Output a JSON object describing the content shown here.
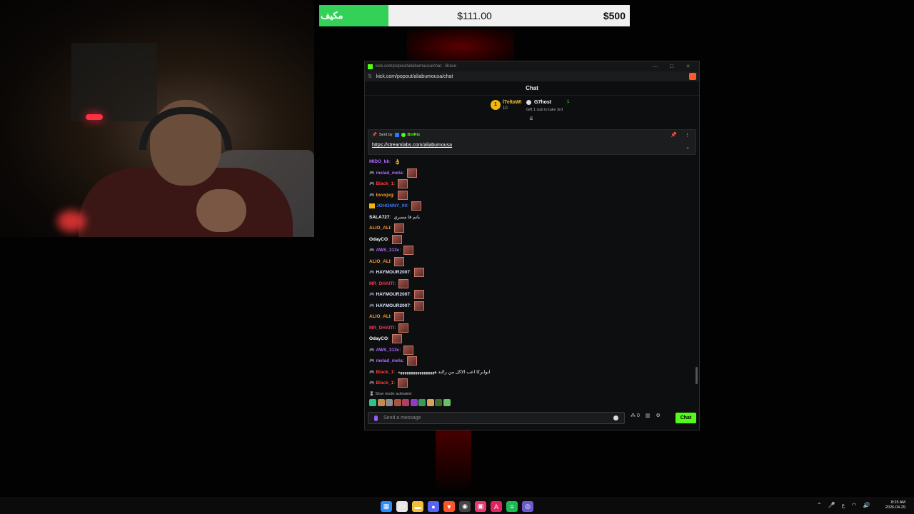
{
  "goal_bar": {
    "label": "مكيف",
    "current": "$111.00",
    "target": "$500",
    "progress_fraction": 0.222,
    "fill_color": "#33d158"
  },
  "browser": {
    "window_title": "kick.com/popout/aliabumousa/chat - Brave",
    "url": "kick.com/popout/aliabumousa/chat",
    "minimize": "—",
    "maximize": "☐",
    "close": "✕"
  },
  "chat": {
    "header": "Chat",
    "leaderboard": {
      "rank": "1",
      "first_name": "l7eltaWI",
      "first_count": "10",
      "second_name": "G7host",
      "second_count": "1",
      "gift_text": "Gift 1 sub to take 3rd"
    },
    "pinned": {
      "sent_by": "Sent by",
      "bot_name": "BotRix",
      "link": "https://streamlabs.com/aliabumousa"
    },
    "messages": [
      {
        "badge": "",
        "user": "MIDO_bk",
        "color": "#b06bff",
        "text": "",
        "emote": "👌",
        "has_emote_img": false
      },
      {
        "badge": "🎮",
        "user": "melad_mela",
        "color": "#b06bff",
        "text": "",
        "emote": "",
        "has_emote_img": true
      },
      {
        "badge": "🎮",
        "user": "Black_1",
        "color": "#ff3b3b",
        "text": "",
        "emote": "",
        "has_emote_img": true
      },
      {
        "badge": "🎮",
        "user": "bxvxjvg",
        "color": "#ff9f2e",
        "text": "",
        "emote": "",
        "has_emote_img": true
      },
      {
        "badge": "crown",
        "user": "JOHGNNY_00",
        "color": "#3b7bff",
        "text": "",
        "emote": "",
        "has_emote_img": true
      },
      {
        "badge": "",
        "user": "SALA727",
        "color": "#ffffff",
        "text": "يانم فا مسري",
        "emote": "",
        "has_emote_img": false
      },
      {
        "badge": "",
        "user": "ALIO_ALI",
        "color": "#ff9f2e",
        "text": "",
        "emote": "",
        "has_emote_img": true
      },
      {
        "badge": "",
        "user": "OdayCO",
        "color": "#ffffff",
        "text": "",
        "emote": "",
        "has_emote_img": true
      },
      {
        "badge": "🎮",
        "user": "AWS_313c",
        "color": "#b06bff",
        "text": "",
        "emote": "",
        "has_emote_img": true
      },
      {
        "badge": "",
        "user": "ALIO_ALI",
        "color": "#ff9f2e",
        "text": "",
        "emote": "",
        "has_emote_img": true
      },
      {
        "badge": "🎮",
        "user": "HAYMOUR2007",
        "color": "#dfe8ff",
        "text": "",
        "emote": "",
        "has_emote_img": true
      },
      {
        "badge": "",
        "user": "MR_DHAITI",
        "color": "#ff3355",
        "text": "",
        "emote": "",
        "has_emote_img": true
      },
      {
        "badge": "🎮",
        "user": "HAYMOUR2007",
        "color": "#dfe8ff",
        "text": "",
        "emote": "",
        "has_emote_img": true
      },
      {
        "badge": "🎮",
        "user": "HAYMOUR2007",
        "color": "#dfe8ff",
        "text": "",
        "emote": "",
        "has_emote_img": true
      },
      {
        "badge": "",
        "user": "ALIO_ALI",
        "color": "#ff9f2e",
        "text": "",
        "emote": "",
        "has_emote_img": true
      },
      {
        "badge": "",
        "user": "MR_DHAITI",
        "color": "#ff3355",
        "text": "",
        "emote": "",
        "has_emote_img": true
      },
      {
        "badge": "",
        "user": "OdayCO",
        "color": "#ffffff",
        "text": "",
        "emote": "",
        "has_emote_img": true
      },
      {
        "badge": "🎮",
        "user": "AWS_313c",
        "color": "#b06bff",
        "text": "",
        "emote": "",
        "has_emote_img": true
      },
      {
        "badge": "🎮",
        "user": "melad_mela",
        "color": "#b06bff",
        "text": "",
        "emote": "",
        "has_emote_img": true
      },
      {
        "badge": "🎮",
        "user": "Black_1",
        "color": "#ff3b3b",
        "text": "ابوابركا اعب الاكل من رالند هههههههههههههههههه",
        "emote": "",
        "has_emote_img": false
      },
      {
        "badge": "🎮",
        "user": "Black_1",
        "color": "#ff3b3b",
        "text": "",
        "emote": "",
        "has_emote_img": true
      }
    ],
    "slow_mode": "Slow mode activated",
    "input_placeholder": "Send a message",
    "chat_button": "Chat",
    "points": "0"
  },
  "taskbar": {
    "time": "8:25 AM",
    "date": "2026-04-29",
    "lang": "ع",
    "apps": [
      {
        "icon": "windows-start-icon",
        "color": "#2b8cff",
        "glyph": "▦"
      },
      {
        "icon": "file-icon",
        "color": "#e6e6e6",
        "glyph": "▭"
      },
      {
        "icon": "folder-icon",
        "color": "#f2c038",
        "glyph": "▬"
      },
      {
        "icon": "discord-icon",
        "color": "#5865f2",
        "glyph": "●"
      },
      {
        "icon": "brave-icon",
        "color": "#fb542b",
        "glyph": "▼"
      },
      {
        "icon": "chrome-icon",
        "color": "#444444",
        "glyph": "◉"
      },
      {
        "icon": "app-icon",
        "color": "#e8376f",
        "glyph": "▣"
      },
      {
        "icon": "adobe-icon",
        "color": "#e0245e",
        "glyph": "A"
      },
      {
        "icon": "spotify-icon",
        "color": "#1db954",
        "glyph": "≡"
      },
      {
        "icon": "obs-icon",
        "color": "#6a5acd",
        "glyph": "◎"
      }
    ]
  }
}
